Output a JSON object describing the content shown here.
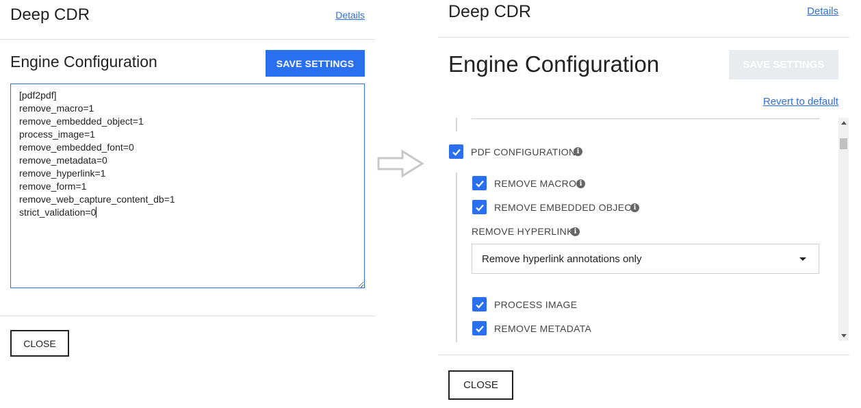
{
  "left": {
    "title": "Deep CDR",
    "details_link": "Details",
    "heading": "Engine Configuration",
    "save_label": "SAVE SETTINGS",
    "config_lines": [
      "[pdf2pdf]",
      "remove_macro=1",
      "remove_embedded_object=1",
      "process_image=1",
      "remove_embedded_font=0",
      "remove_metadata=0",
      "remove_hyperlink=1",
      "remove_form=1",
      "remove_web_capture_content_db=1",
      "strict_validation=0"
    ],
    "close_label": "CLOSE"
  },
  "arrow": {
    "icon": "arrow-right-icon",
    "color": "#c8c8c8"
  },
  "right": {
    "title": "Deep CDR",
    "details_link": "Details",
    "heading": "Engine Configuration",
    "save_label": "SAVE SETTINGS",
    "revert_label": "Revert to default",
    "pdf_section": {
      "label": "PDF CONFIGURATION",
      "checked": true,
      "options": [
        {
          "label": "REMOVE MACRO",
          "checked": true
        },
        {
          "label": "REMOVE EMBEDDED OBJECT",
          "checked": true
        }
      ],
      "hyperlink_label": "REMOVE HYPERLINK",
      "hyperlink_value": "Remove hyperlink annotations only",
      "more_options": [
        {
          "label": "PROCESS IMAGE",
          "checked": true
        },
        {
          "label": "REMOVE METADATA",
          "checked": true
        }
      ]
    },
    "close_label": "CLOSE"
  },
  "colors": {
    "accent": "#2a6ff0",
    "link": "#2f6fe0",
    "disabled_button": "#e9ecef",
    "divider": "#dcdcdc"
  }
}
